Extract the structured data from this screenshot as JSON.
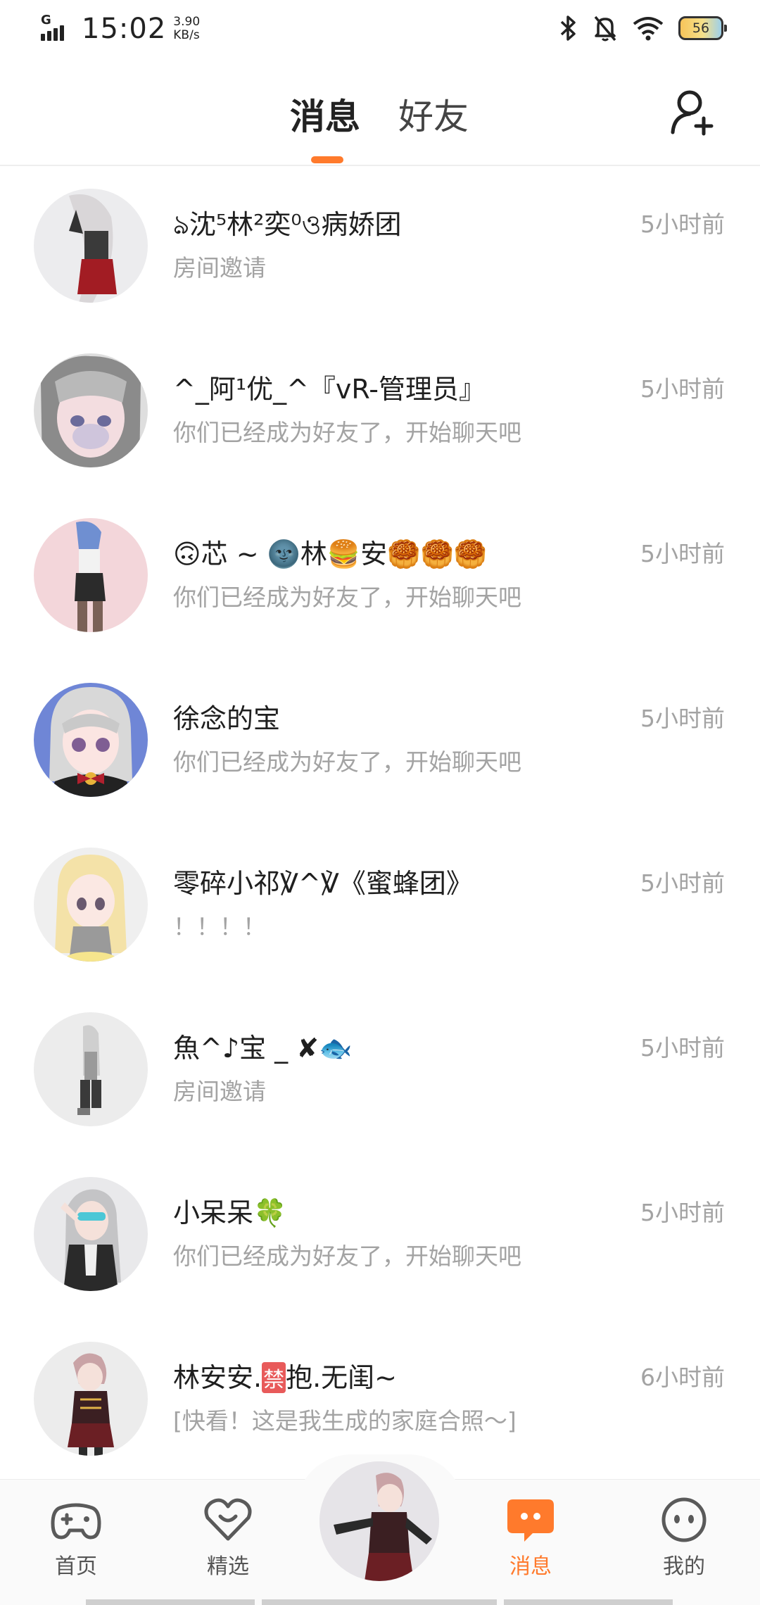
{
  "status_bar": {
    "network": "G",
    "time": "15:02",
    "speed_value": "3.90",
    "speed_unit": "KB/s",
    "battery": "56"
  },
  "header": {
    "tabs": [
      {
        "label": "消息",
        "active": true
      },
      {
        "label": "好友",
        "active": false
      }
    ],
    "add_friend_icon": "add-user-icon",
    "accent": "#ff7a2c"
  },
  "messages": [
    {
      "name": "ঌ沈⁵林²奕⁰ও病娇团",
      "preview": "房间邀请",
      "time": "5小时前"
    },
    {
      "name": "^_阿¹优_^『vR-管理员』",
      "preview": "你们已经成为好友了，开始聊天吧",
      "time": "5小时前"
    },
    {
      "name": "🙃芯 ~ 🌚林🍔安🥮🥮🥮",
      "preview": "你们已经成为好友了，开始聊天吧",
      "time": "5小时前"
    },
    {
      "name": "徐念的宝",
      "preview": "你们已经成为好友了，开始聊天吧",
      "time": "5小时前"
    },
    {
      "name": "零碎小祁℣^℣《蜜蜂团》",
      "preview": "！！！！",
      "time": "5小时前"
    },
    {
      "name": "魚^♪宝 _ ✘🐟",
      "preview": "房间邀请",
      "time": "5小时前"
    },
    {
      "name": "小呆呆🍀",
      "preview": "你们已经成为好友了，开始聊天吧",
      "time": "5小时前"
    },
    {
      "name_prefix": "林安安.",
      "name_badge": "禁",
      "name_suffix": "抱.无闺~",
      "preview": "[快看！这是我生成的家庭合照～]",
      "time": "6小时前"
    }
  ],
  "bottom_nav": [
    {
      "label": "首页",
      "icon": "gamepad-icon"
    },
    {
      "label": "精选",
      "icon": "heart-smile-icon"
    },
    {
      "label": "消息",
      "icon": "chat-bubble-icon",
      "active": true
    },
    {
      "label": "我的",
      "icon": "face-icon"
    }
  ]
}
